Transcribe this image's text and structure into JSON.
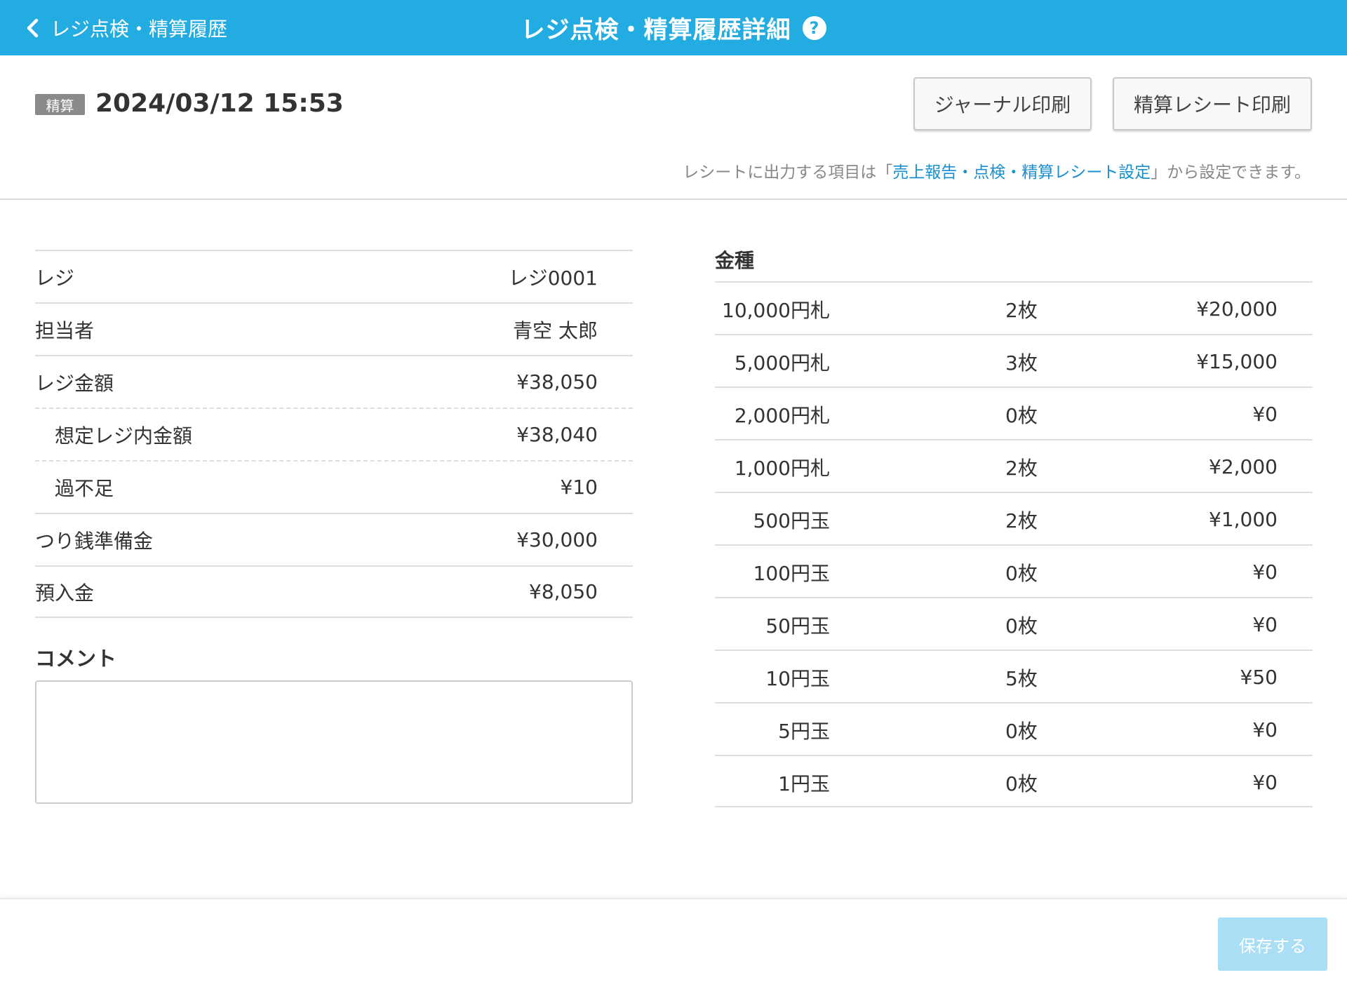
{
  "header": {
    "back_label": "レジ点検・精算履歴",
    "title": "レジ点検・精算履歴詳細",
    "help_symbol": "?",
    "bg_color": "#23ace2"
  },
  "record": {
    "tag": "精算",
    "datetime": "2024/03/12 15:53"
  },
  "actions": {
    "journal_print": "ジャーナル印刷",
    "receipt_print": "精算レシート印刷"
  },
  "note": {
    "prefix": "レシートに出力する項目は「",
    "link": "売上報告・点検・精算レシート設定",
    "suffix": "」から設定できます。"
  },
  "info": [
    {
      "label": "レジ",
      "value": "レジ0001"
    },
    {
      "label": "担当者",
      "value": "青空 太郎"
    },
    {
      "label": "レジ金額",
      "value": "¥38,050"
    },
    {
      "label": "想定レジ内金額",
      "value": "¥38,040"
    },
    {
      "label": "過不足",
      "value": "¥10"
    },
    {
      "label": "つり銭準備金",
      "value": "¥30,000"
    },
    {
      "label": "預入金",
      "value": "¥8,050"
    }
  ],
  "comment": {
    "title": "コメント",
    "value": ""
  },
  "denominations": {
    "title": "金種",
    "rows": [
      {
        "name": "10,000円札",
        "count": "2枚",
        "amount": "¥20,000"
      },
      {
        "name": "5,000円札",
        "count": "3枚",
        "amount": "¥15,000"
      },
      {
        "name": "2,000円札",
        "count": "0枚",
        "amount": "¥0"
      },
      {
        "name": "1,000円札",
        "count": "2枚",
        "amount": "¥2,000"
      },
      {
        "name": "500円玉",
        "count": "2枚",
        "amount": "¥1,000"
      },
      {
        "name": "100円玉",
        "count": "0枚",
        "amount": "¥0"
      },
      {
        "name": "50円玉",
        "count": "0枚",
        "amount": "¥0"
      },
      {
        "name": "10円玉",
        "count": "5枚",
        "amount": "¥50"
      },
      {
        "name": "5円玉",
        "count": "0枚",
        "amount": "¥0"
      },
      {
        "name": "1円玉",
        "count": "0枚",
        "amount": "¥0"
      }
    ]
  },
  "footer": {
    "save_label": "保存する",
    "save_color": "#a9def4"
  }
}
